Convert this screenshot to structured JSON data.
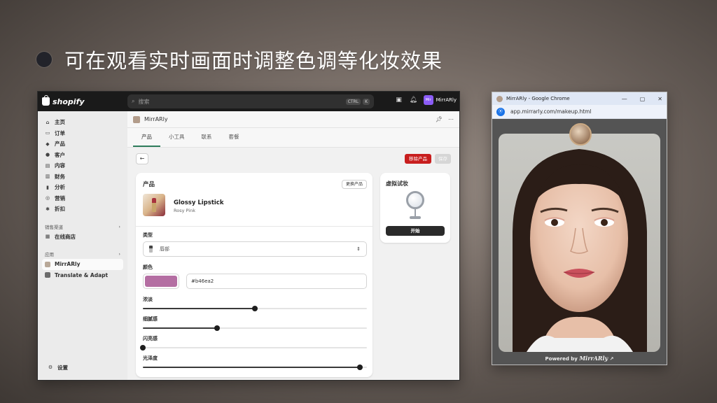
{
  "slide": {
    "title": "可在观看实时画面时调整色调等化妆效果"
  },
  "shopify": {
    "logo_text": "shopify",
    "search_placeholder": "搜索",
    "search_kbd": [
      "CTRL",
      "K"
    ],
    "store_initials": "Mir",
    "store_name": "MirrARly",
    "nav": [
      {
        "label": "主页",
        "icon": "home-icon",
        "glyph": "⌂"
      },
      {
        "label": "订单",
        "icon": "inbox-icon",
        "glyph": "▭"
      },
      {
        "label": "产品",
        "icon": "tag-icon",
        "glyph": "◆"
      },
      {
        "label": "客户",
        "icon": "person-icon",
        "glyph": "●"
      },
      {
        "label": "内容",
        "icon": "image-icon",
        "glyph": "▤"
      },
      {
        "label": "财务",
        "icon": "bank-icon",
        "glyph": "▥"
      },
      {
        "label": "分析",
        "icon": "chart-icon",
        "glyph": "▮"
      },
      {
        "label": "营销",
        "icon": "target-icon",
        "glyph": "◎"
      },
      {
        "label": "折扣",
        "icon": "discount-icon",
        "glyph": "✱"
      }
    ],
    "sales_channels_label": "销售渠道",
    "online_store": "在线商店",
    "apps_label": "应用",
    "apps": [
      "MirrARly",
      "Translate & Adapt"
    ],
    "settings": "设置",
    "app_header_title": "MirrARly",
    "tabs": [
      "产品",
      "小工具",
      "联系",
      "套餐"
    ],
    "remove_button": "移除产品",
    "save_button": "保存",
    "product_card": {
      "title": "产品",
      "change_button": "更换产品",
      "product_name": "Glossy Lipstick",
      "product_variant": "Rosy Pink",
      "type_label": "类型",
      "type_value": "唇部",
      "color_label": "颜色",
      "color_hex": "#b46ea2",
      "sliders": [
        {
          "label": "浓淡",
          "value": 0.5
        },
        {
          "label": "细腻感",
          "value": 0.33
        },
        {
          "label": "闪亮感",
          "value": 0.0
        },
        {
          "label": "光泽度",
          "value": 0.97
        }
      ]
    },
    "try_on_card": {
      "title": "虚拟试妆",
      "start_button": "开始"
    }
  },
  "chrome": {
    "window_title": "MirrARly - Google Chrome",
    "url": "app.mirrarly.com/makeup.html",
    "powered_by": "Powered by",
    "brand": "MirrARly"
  }
}
